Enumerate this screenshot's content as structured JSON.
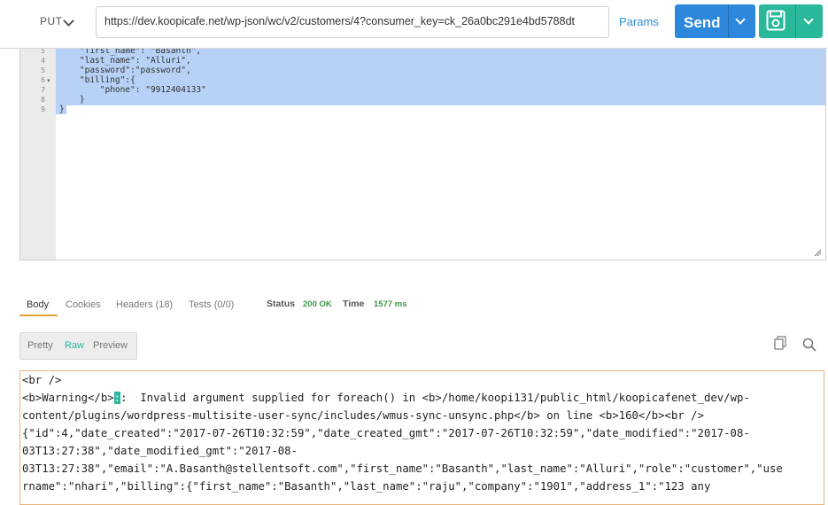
{
  "request": {
    "method": "PUT",
    "url": "https://dev.koopicafe.net/wp-json/wc/v2/customers/4?consumer_key=ck_26a0bc291e4bd5788dt",
    "params_label": "Params",
    "send_label": "Send"
  },
  "editor": {
    "line_numbers": [
      "5",
      "4",
      "5",
      "6",
      "7",
      "8",
      "9"
    ],
    "lines": [
      "    \"first_name\": \"Basanth\",",
      "    \"last_name\": \"Alluri\",",
      "    \"password\":\"password\",",
      "    \"billing\":{",
      "        \"phone\": \"9912404133\"",
      "    }",
      "}"
    ]
  },
  "response_tabs": {
    "body": "Body",
    "cookies": "Cookies",
    "headers": "Headers (18)",
    "tests": "Tests (0/0)",
    "status_label": "Status",
    "status_value": "200 OK",
    "time_label": "Time",
    "time_value": "1577 ms"
  },
  "format": {
    "pretty": "Pretty",
    "raw": "Raw",
    "preview": "Preview"
  },
  "response": {
    "lines": [
      "<br />",
      "<b>Warning</b>",
      ":  Invalid argument supplied for foreach() in <b>/home/koopi131/public_html/koopicafenet_dev/wp-",
      "content/plugins/wordpress-multisite-user-sync/includes/wmus-sync-unsync.php</b> on line <b>160</b><br />",
      "{\"id\":4,\"date_created\":\"2017-07-26T10:32:59\",\"date_created_gmt\":\"2017-07-26T10:32:59\",\"date_modified\":\"2017-08-",
      "03T13:27:38\",\"date_modified_gmt\":\"2017-08-",
      "03T13:27:38\",\"email\":\"A.Basanth@stellentsoft.com\",\"first_name\":\"Basanth\",\"last_name\":\"Alluri\",\"role\":\"customer\",\"use",
      "rname\":\"nhari\",\"billing\":{\"first_name\":\"Basanth\",\"last_name\":\"raju\",\"company\":\"1901\",\"address_1\":\"123 any"
    ]
  }
}
